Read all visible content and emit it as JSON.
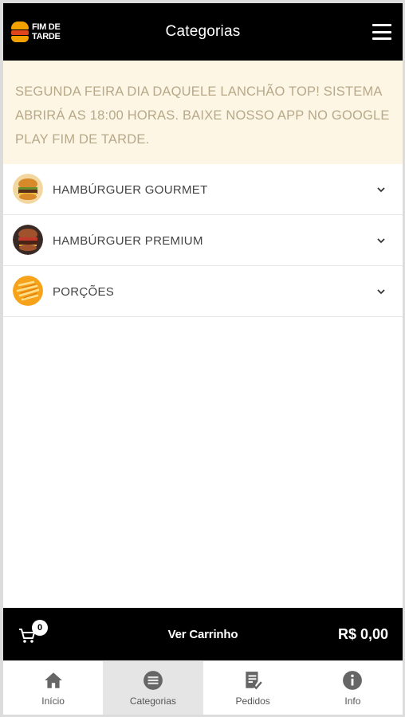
{
  "header": {
    "logo_line1": "FIM DE",
    "logo_line2": "TARDE",
    "title": "Categorias"
  },
  "notice": {
    "text": "SEGUNDA FEIRA DIA DAQUELE LANCHÃO TOP! SISTEMA ABRIRÁ AS 18:00 HORAS. BAIXE NOSSO APP NO GOOGLE PLAY FIM DE TARDE."
  },
  "categories": [
    {
      "label": "HAMBÚRGUER GOURMET",
      "thumb": "burger-gourmet"
    },
    {
      "label": "HAMBÚRGUER PREMIUM",
      "thumb": "burger-premium"
    },
    {
      "label": "PORÇÕES",
      "thumb": "fries"
    }
  ],
  "cart": {
    "count": "0",
    "label": "Ver Carrinho",
    "total": "R$ 0,00"
  },
  "nav": {
    "items": [
      {
        "label": "Início",
        "icon": "home-icon",
        "active": false
      },
      {
        "label": "Categorias",
        "icon": "list-circle-icon",
        "active": true
      },
      {
        "label": "Pedidos",
        "icon": "orders-icon",
        "active": false
      },
      {
        "label": "Info",
        "icon": "info-icon",
        "active": false
      }
    ]
  },
  "colors": {
    "bar_bg": "#000000",
    "notice_bg": "#fdf6e4",
    "notice_text": "#b7a98a",
    "active_nav_bg": "#e5e5e5"
  }
}
